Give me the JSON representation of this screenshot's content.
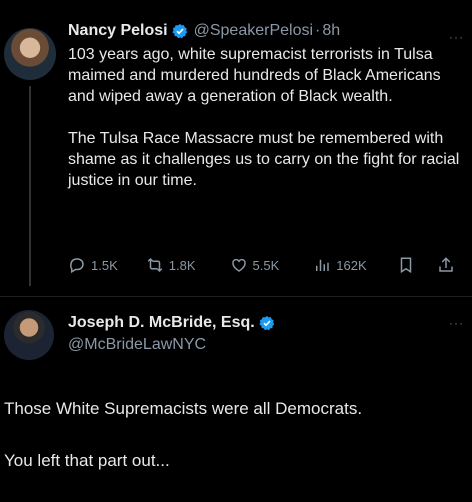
{
  "tweet1": {
    "name": "Nancy Pelosi",
    "handle": "@SpeakerPelosi",
    "separator": "·",
    "time": "8h",
    "paragraph1": "103 years ago, white supremacist terrorists in Tulsa maimed and murdered hundreds of Black Americans and wiped away a generation of Black wealth.",
    "paragraph2": "The Tulsa Race Massacre must be remembered with shame as it challenges us to carry on the fight for racial justice in our time.",
    "replies": "1.5K",
    "reposts": "1.8K",
    "likes": "5.5K",
    "views": "162K",
    "more": "···"
  },
  "tweet2": {
    "name": "Joseph D. McBride, Esq.",
    "handle": "@McBrideLawNYC",
    "more": "···",
    "line1": "Those White Supremacists were all Democrats.",
    "line2": "You left that part out..."
  },
  "colors": {
    "background": "#000000",
    "text": "#e7e9ea",
    "muted": "#8b98a5",
    "verified": "#1d9bf0"
  },
  "icons": [
    "verified-badge-icon",
    "reply-icon",
    "repost-icon",
    "like-icon",
    "views-icon",
    "bookmark-icon",
    "share-icon",
    "more-icon"
  ]
}
